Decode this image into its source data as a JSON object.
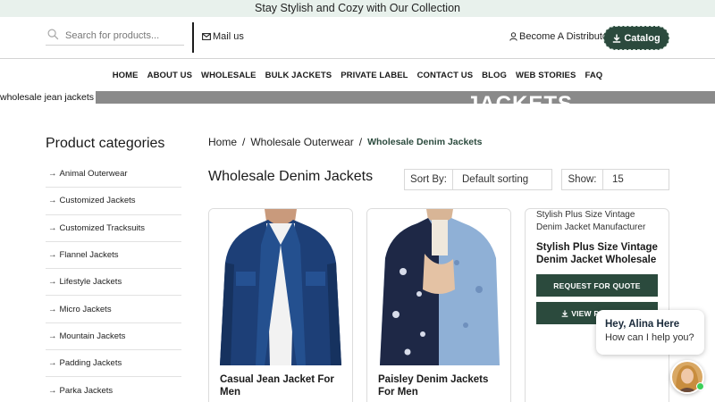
{
  "topbar": {
    "text": "Stay Stylish and Cozy with Our Collection"
  },
  "header": {
    "search_placeholder": "Search for products...",
    "mail_label": "Mail us",
    "distributor_label": "Become A Distributor",
    "catalog_label": "Catalog"
  },
  "nav": {
    "items": [
      "HOME",
      "ABOUT US",
      "WHOLESALE",
      "BULK JACKETS",
      "PRIVATE LABEL",
      "CONTACT US",
      "BLOG",
      "WEB STORIES",
      "FAQ"
    ]
  },
  "hero": {
    "alt_text": "wholesale jean jackets",
    "big_text": "JACKETS"
  },
  "sidebar": {
    "title": "Product categories",
    "categories": [
      "Animal Outerwear",
      "Customized Jackets",
      "Customized Tracksuits",
      "Flannel Jackets",
      "Lifestyle Jackets",
      "Micro Jackets",
      "Mountain Jackets",
      "Padding Jackets",
      "Parka Jackets"
    ]
  },
  "breadcrumb": {
    "home": "Home",
    "parent": "Wholesale Outerwear",
    "current": "Wholesale Denim Jackets",
    "separator": "/"
  },
  "main": {
    "title": "Wholesale Denim Jackets",
    "sort_label": "Sort By:",
    "sort_value": "Default sorting",
    "show_label": "Show:",
    "show_value": "15"
  },
  "products": [
    {
      "name": "Casual Jean Jacket For Men"
    },
    {
      "name": "Paisley Denim Jackets For Men"
    },
    {
      "subtitle": "Stylish Plus Size Vintage Denim Jacket Manufacturer",
      "name": "Stylish Plus Size Vintage Denim Jacket Wholesale",
      "quote_button": "REQUEST FOR QUOTE",
      "view_button": "VIEW PRODUCT"
    }
  ],
  "chat": {
    "greeting": "Hey, Alina Here",
    "prompt": "How can I help you?"
  },
  "colors": {
    "brand_green": "#2b4a3d",
    "topbar_bg": "#e8f1ec",
    "online": "#3ccf5a"
  }
}
